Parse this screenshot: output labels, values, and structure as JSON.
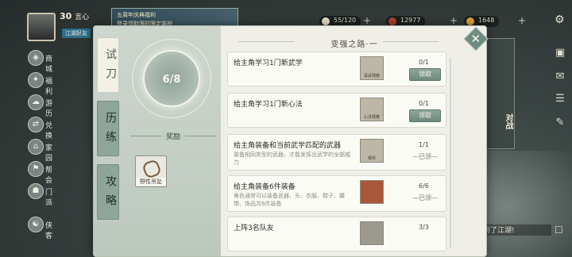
{
  "player": {
    "level": "30",
    "name": "言心",
    "badge": "江湖好友"
  },
  "event_banner": {
    "line1": "五周年庆典福利",
    "line2": "登录领取限时限定装扮"
  },
  "resources": [
    {
      "value": "55/120",
      "color": "#e8e1c7"
    },
    {
      "value": "12977",
      "color": "#b0402e"
    },
    {
      "value": "1648",
      "color": "#e0a13a"
    }
  ],
  "side_menu": [
    {
      "label": "商城",
      "icon": "shop-icon"
    },
    {
      "label": "福利",
      "icon": "gift-icon"
    },
    {
      "label": "游历",
      "icon": "travel-icon"
    },
    {
      "label": "兑换",
      "icon": "exchange-icon"
    },
    {
      "label": "家园",
      "icon": "home-icon"
    },
    {
      "label": "帮会",
      "icon": "guild-icon"
    },
    {
      "label": "门派",
      "icon": "sect-icon"
    },
    {
      "label": "侠客",
      "icon": "hero-icon"
    }
  ],
  "vs_card": "对战",
  "chat": {
    "text": "中来到了江湖!"
  },
  "dialog": {
    "tabs": [
      "试刀",
      "历练",
      "攻略"
    ],
    "active_tab": 0,
    "progress": "6/8",
    "reward_label": "奖励",
    "reward_item": "野性吊坠",
    "panel_title": "变强之路·一",
    "tasks": [
      {
        "name": "给主角学习1门新武学",
        "desc": "",
        "count": "0/1",
        "icon_caption": "百武残卷",
        "action": "领取",
        "claimed": false
      },
      {
        "name": "给主角学习1门新心法",
        "desc": "",
        "count": "0/1",
        "icon_caption": "心法残卷",
        "action": "领取",
        "claimed": false
      },
      {
        "name": "给主角装备和当前武学匹配的武器",
        "desc": "装备相同类型的武器，才能发挥出武学的全部威力",
        "count": "1/1",
        "icon_caption": "铜币",
        "action": "已领",
        "claimed": true
      },
      {
        "name": "给主角装备6件装备",
        "desc": "角色通常可以装备武器、头、衣服、鞋子、腰带、饰品共6件装备",
        "count": "6/6",
        "icon_caption": "",
        "action": "已领",
        "claimed": true
      },
      {
        "name": "上阵3名队友",
        "desc": "",
        "count": "3/3",
        "icon_caption": "",
        "action": "",
        "claimed": true
      }
    ]
  }
}
